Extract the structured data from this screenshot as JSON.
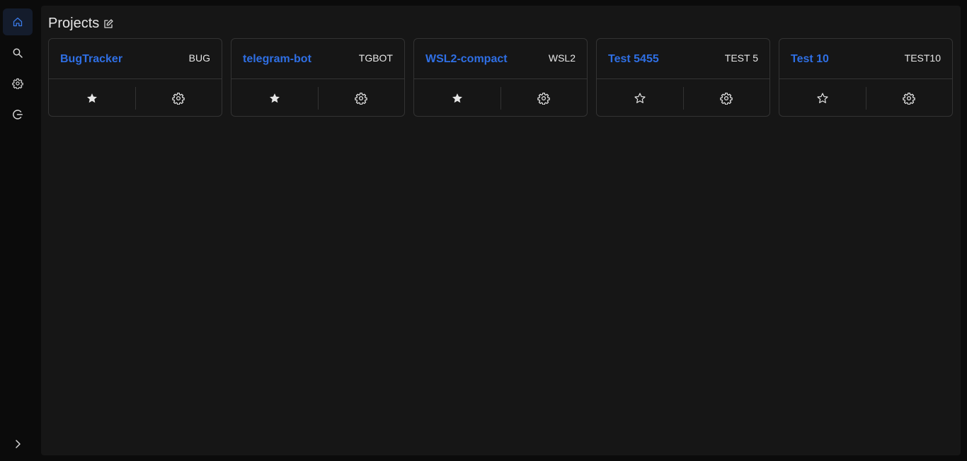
{
  "sidebar": {
    "items": [
      {
        "name": "home",
        "icon": "home-icon",
        "active": true
      },
      {
        "name": "search",
        "icon": "search-icon",
        "active": false
      },
      {
        "name": "settings",
        "icon": "gear-icon",
        "active": false
      },
      {
        "name": "logout",
        "icon": "logout-icon",
        "active": false
      }
    ],
    "expand_icon": "chevron-right-icon"
  },
  "header": {
    "title": "Projects"
  },
  "projects": [
    {
      "name": "BugTracker",
      "key": "BUG",
      "favorite": true
    },
    {
      "name": "telegram-bot",
      "key": "TGBOT",
      "favorite": true
    },
    {
      "name": "WSL2-compact",
      "key": "WSL2",
      "favorite": true
    },
    {
      "name": "Test 5455",
      "key": "TEST 5",
      "favorite": false
    },
    {
      "name": "Test 10",
      "key": "TEST10",
      "favorite": false
    }
  ],
  "colors": {
    "accent": "#2f6fe4",
    "background": "#161616",
    "sidebar": "#0b0b0b",
    "border": "#333333"
  }
}
